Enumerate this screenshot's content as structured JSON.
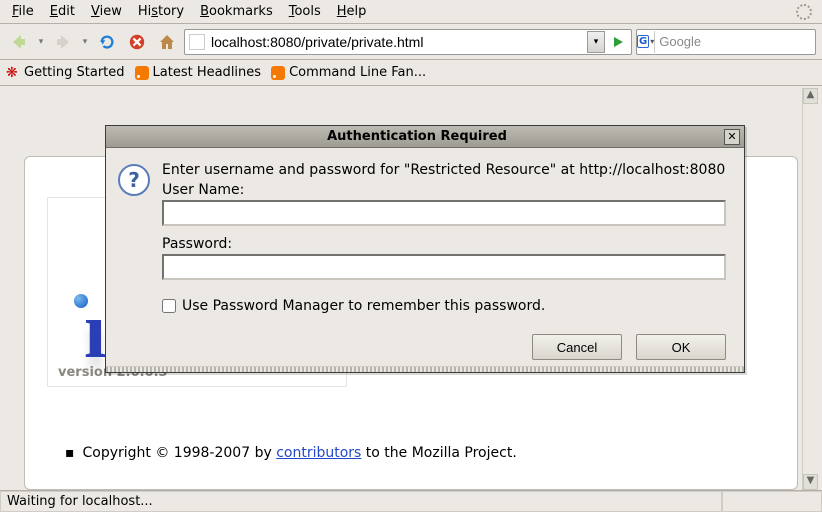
{
  "menu": {
    "file": "File",
    "edit": "Edit",
    "view": "View",
    "history": "History",
    "bookmarks": "Bookmarks",
    "tools": "Tools",
    "help": "Help"
  },
  "toolbar": {
    "url": "localhost:8080/private/private.html",
    "search_placeholder": "Google",
    "search_engine": "G"
  },
  "bookmarks_bar": {
    "getting_started": "Getting Started",
    "latest_headlines": "Latest Headlines",
    "command_line_fan": "Command Line Fan..."
  },
  "page": {
    "version": "version 2.0.0.3",
    "copyright_pre": "Copyright © 1998-2007 by ",
    "copyright_link": "contributors",
    "copyright_post": " to the Mozilla Project."
  },
  "dialog": {
    "title": "Authentication Required",
    "prompt": "Enter username and password for \"Restricted Resource\" at http://localhost:8080",
    "username_label": "User Name:",
    "password_label": "Password:",
    "username_value": "",
    "password_value": "",
    "remember": "Use Password Manager to remember this password.",
    "cancel": "Cancel",
    "ok": "OK"
  },
  "statusbar": {
    "text": "Waiting for localhost..."
  }
}
